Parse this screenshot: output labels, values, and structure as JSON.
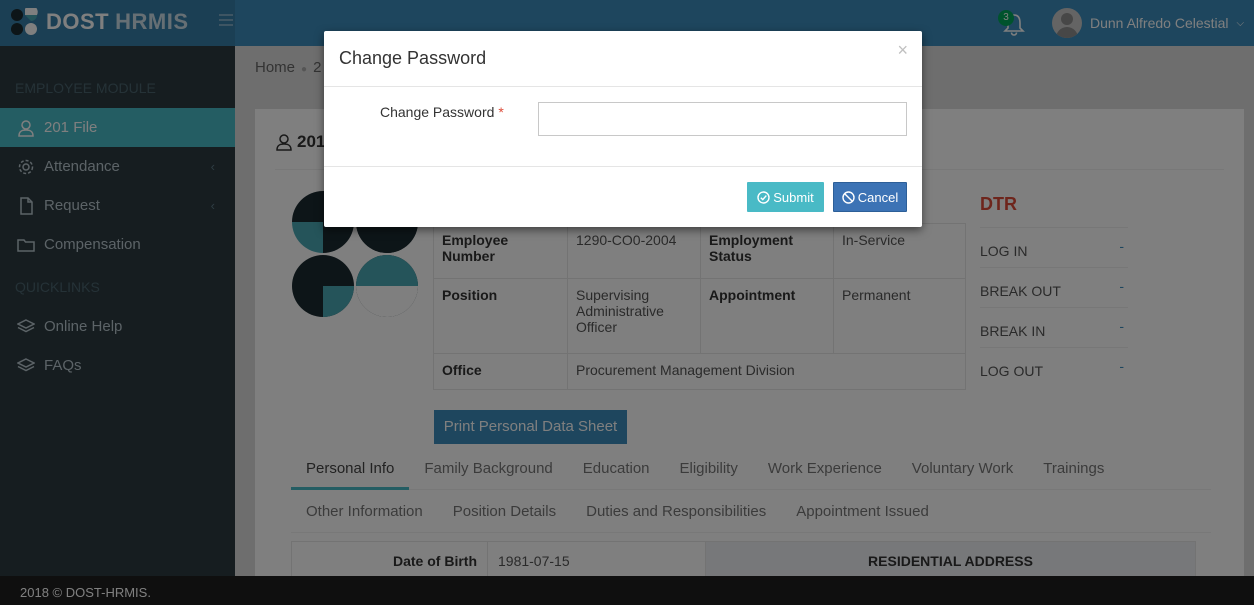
{
  "header": {
    "brand_a": "DOST",
    "brand_b": "HRMIS",
    "notification_count": "3",
    "user_name": "Dunn Alfredo Celestial"
  },
  "sidebar": {
    "section_employee": "EMPLOYEE MODULE",
    "section_quicklinks": "QUICKLINKS",
    "items": [
      {
        "label": "201 File",
        "icon": "user-icon"
      },
      {
        "label": "Attendance",
        "icon": "gear-icon"
      },
      {
        "label": "Request",
        "icon": "file-icon"
      },
      {
        "label": "Compensation",
        "icon": "folder-icon"
      },
      {
        "label": "Online Help",
        "icon": "layers-icon"
      },
      {
        "label": "FAQs",
        "icon": "layers-icon"
      }
    ]
  },
  "breadcrumb": {
    "home": "Home",
    "current": "2"
  },
  "page": {
    "title": "201"
  },
  "employee": {
    "labels": {
      "employee_number": "Employee Number",
      "employment_status": "Employment Status",
      "position": "Position",
      "appointment": "Appointment",
      "office": "Office"
    },
    "values": {
      "employee_number": "1290-CO0-2004",
      "employment_status": "In-Service",
      "position": "Supervising Administrative Officer",
      "appointment": "Permanent",
      "office": "Procurement Management Division"
    }
  },
  "dtr": {
    "title": "DTR",
    "rows": [
      {
        "label": "LOG IN",
        "value": "-"
      },
      {
        "label": "BREAK OUT",
        "value": "-"
      },
      {
        "label": "BREAK IN",
        "value": "-"
      },
      {
        "label": "LOG OUT",
        "value": "-"
      }
    ]
  },
  "print_button": "Print Personal Data Sheet",
  "tabs": {
    "row1": [
      "Personal Info",
      "Family Background",
      "Education",
      "Eligibility",
      "Work Experience",
      "Voluntary Work",
      "Trainings"
    ],
    "row2": [
      "Other Information",
      "Position Details",
      "Duties and Responsibilities",
      "Appointment Issued"
    ]
  },
  "personal": {
    "dob_label": "Date of Birth",
    "dob_value": "1981-07-15",
    "res_address": "RESIDENTIAL ADDRESS"
  },
  "footer": {
    "text": "2018 © DOST-HRMIS."
  },
  "modal": {
    "title": "Change Password",
    "close": "×",
    "field_label": "Change Password",
    "required_mark": "*",
    "submit": "Submit",
    "cancel": "Cancel"
  },
  "colors": {
    "primary": "#3c8dbc",
    "accent": "#49bac6",
    "sidebar": "#2c3b41",
    "danger": "#dd4b39"
  }
}
